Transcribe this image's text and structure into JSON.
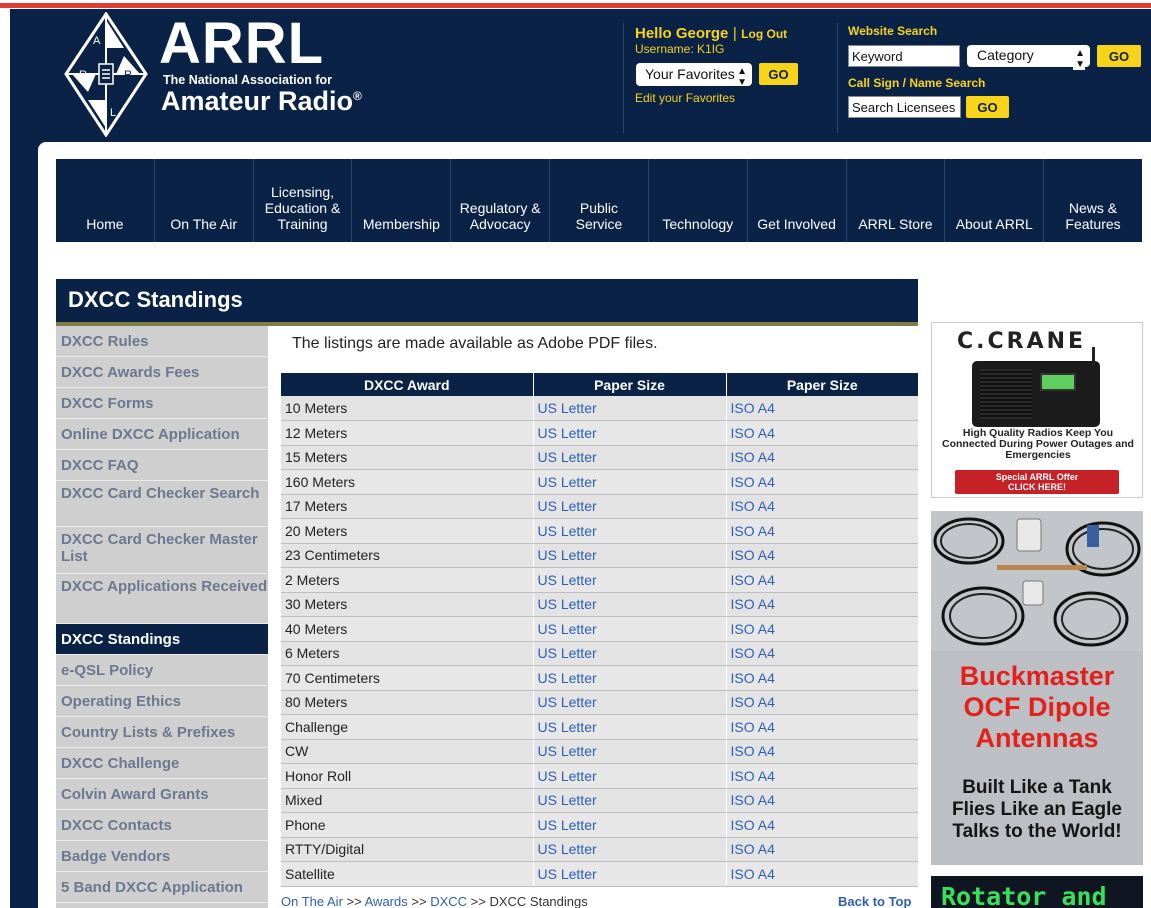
{
  "header": {
    "logo": {
      "big": "ARRL",
      "sub": "The National Association for",
      "name": "Amateur Radio",
      "reg": "®",
      "diamond_letters": [
        "A",
        "R",
        "R",
        "L"
      ]
    },
    "user": {
      "greeting": "Hello George",
      "separator": "|",
      "logout": "Log Out",
      "username": "Username: K1IG",
      "favorites_select": "Your Favorites",
      "go": "GO",
      "edit_favorites": "Edit your Favorites"
    },
    "search": {
      "label": "Website Search",
      "keyword_placeholder": "Keyword",
      "category": "Category",
      "go": "GO",
      "callsign_label": "Call Sign / Name Search",
      "licensee_placeholder": "Search Licensees",
      "licensee_go": "GO"
    }
  },
  "nav": [
    "Home",
    "On The Air",
    "Licensing,\nEducation &\nTraining",
    "Membership",
    "Regulatory &\nAdvocacy",
    "Public\nService",
    "Technology",
    "Get Involved",
    "ARRL Store",
    "About ARRL",
    "News &\nFeatures"
  ],
  "page_title": "DXCC Standings",
  "sidebar": [
    {
      "label": "DXCC Rules",
      "active": false
    },
    {
      "label": "DXCC Awards Fees",
      "active": false
    },
    {
      "label": "DXCC Forms",
      "active": false
    },
    {
      "label": "Online DXCC Application",
      "active": false
    },
    {
      "label": "DXCC FAQ",
      "active": false
    },
    {
      "label": "DXCC Card Checker Search",
      "active": false
    },
    {
      "label": "DXCC Card Checker Master List",
      "active": false
    },
    {
      "label": "DXCC Applications Received",
      "active": false
    },
    {
      "label": "DXCC Standings",
      "active": true
    },
    {
      "label": "e-QSL Policy",
      "active": false
    },
    {
      "label": "Operating Ethics",
      "active": false
    },
    {
      "label": "Country Lists & Prefixes",
      "active": false
    },
    {
      "label": "DXCC Challenge",
      "active": false
    },
    {
      "label": "Colvin Award Grants",
      "active": false
    },
    {
      "label": "DXCC Contacts",
      "active": false
    },
    {
      "label": "Badge Vendors",
      "active": false
    },
    {
      "label": "5 Band DXCC Application",
      "active": false
    }
  ],
  "intro": "The listings are made available as Adobe PDF files.",
  "table": {
    "headers": [
      "DXCC Award",
      "Paper Size",
      "Paper Size"
    ],
    "rows": [
      [
        "10 Meters",
        "US Letter",
        "ISO A4"
      ],
      [
        "12 Meters",
        "US Letter",
        "ISO A4"
      ],
      [
        "15 Meters",
        "US Letter",
        "ISO A4"
      ],
      [
        "160 Meters",
        "US Letter",
        "ISO A4"
      ],
      [
        "17 Meters",
        "US Letter",
        "ISO A4"
      ],
      [
        "20 Meters",
        "US Letter",
        "ISO A4"
      ],
      [
        "23 Centimeters",
        "US Letter",
        "ISO A4"
      ],
      [
        "2 Meters",
        "US Letter",
        "ISO A4"
      ],
      [
        "30 Meters",
        "US Letter",
        "ISO A4"
      ],
      [
        "40 Meters",
        "US Letter",
        "ISO A4"
      ],
      [
        "6 Meters",
        "US Letter",
        "ISO A4"
      ],
      [
        "70 Centimeters",
        "US Letter",
        "ISO A4"
      ],
      [
        "80 Meters",
        "US Letter",
        "ISO A4"
      ],
      [
        "Challenge",
        "US Letter",
        "ISO A4"
      ],
      [
        "CW",
        "US Letter",
        "ISO A4"
      ],
      [
        "Honor Roll",
        "US Letter",
        "ISO A4"
      ],
      [
        "Mixed",
        "US Letter",
        "ISO A4"
      ],
      [
        "Phone",
        "US Letter",
        "ISO A4"
      ],
      [
        "RTTY/Digital",
        "US Letter",
        "ISO A4"
      ],
      [
        "Satellite",
        "US Letter",
        "ISO A4"
      ]
    ]
  },
  "breadcrumb": {
    "items": [
      "On The Air",
      "Awards",
      "DXCC",
      "DXCC Standings"
    ],
    "separator": ">>",
    "back_to_top": "Back to Top"
  },
  "ads": {
    "ccrane": {
      "brand": "C.CRANE",
      "text": "High Quality Radios Keep You Connected During Power Outages and Emergencies",
      "button_line1": "Special ARRL Offer",
      "button_line2": "CLICK HERE!"
    },
    "buckmaster": {
      "headline": [
        "Buckmaster",
        "OCF Dipole",
        "Antennas"
      ],
      "tagline": [
        "Built Like a Tank",
        "Flies Like an Eagle",
        "Talks to the World!"
      ]
    },
    "rotator": {
      "text": "Rotator and"
    }
  },
  "colors": {
    "navy": "#0b2247",
    "gold": "#f7d31a",
    "accent_red": "#e03c31",
    "link_blue": "#2e5fb3",
    "sidebar_gray": "#cfcfcf",
    "olive_rule": "#7f7c49"
  }
}
